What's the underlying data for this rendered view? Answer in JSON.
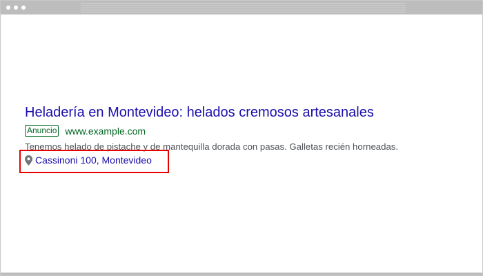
{
  "ad": {
    "title": "Heladería en Montevideo: helados cremosos artesanales",
    "badge": "Anuncio",
    "display_url": "www.example.com",
    "description": "Tenemos helado de pistache y de mantequilla dorada con pasas. Galletas recién horneadas.",
    "location": "Cassinoni 100, Montevideo",
    "location_icon": "map-pin-icon"
  },
  "colors": {
    "title_link": "#1a0dab",
    "url_green": "#006621",
    "highlight": "#e60000",
    "window_chrome": "#bdbdbd"
  }
}
